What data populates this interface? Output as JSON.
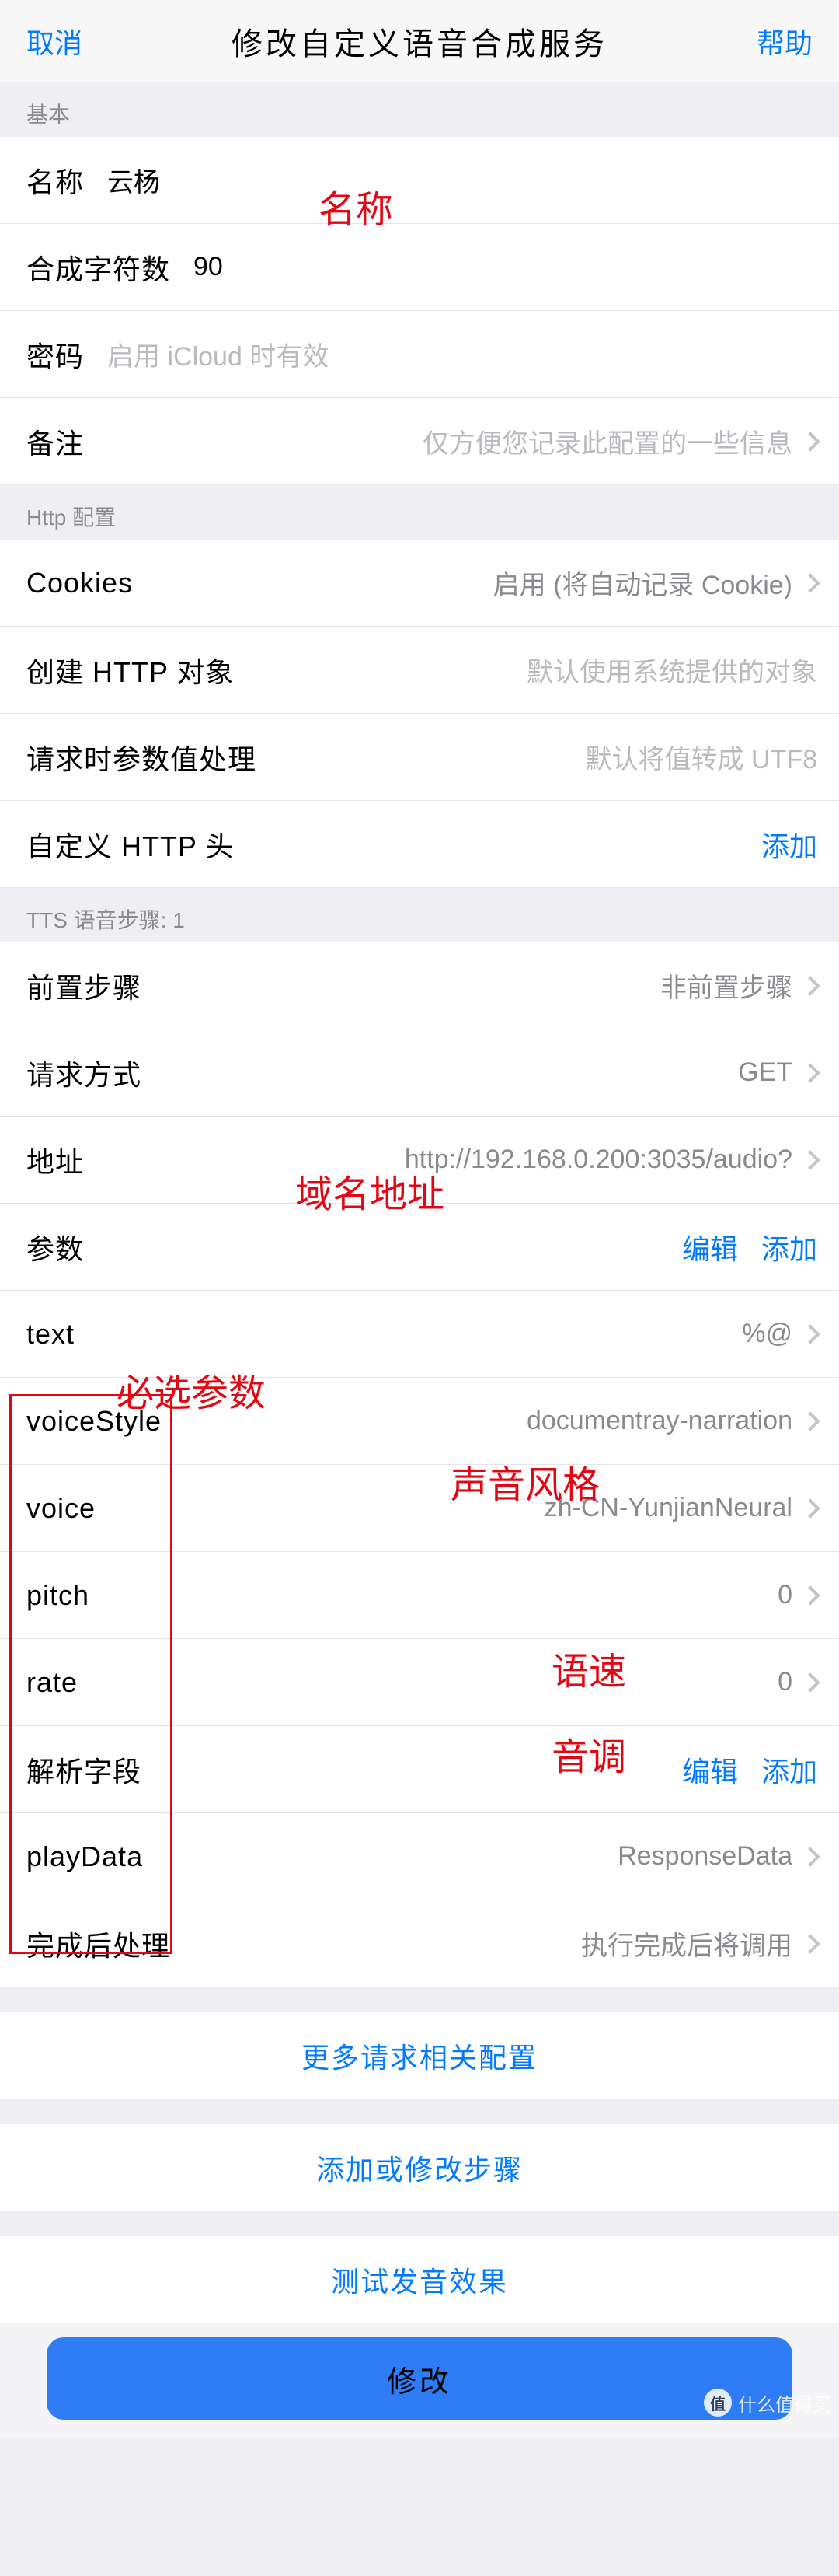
{
  "nav": {
    "cancel": "取消",
    "title": "修改自定义语音合成服务",
    "help": "帮助"
  },
  "sections": {
    "basic": "基本",
    "http": "Http 配置",
    "tts": "TTS 语音步骤: 1"
  },
  "basic": {
    "name_label": "名称",
    "name_value": "云杨",
    "chars_label": "合成字符数",
    "chars_value": "90",
    "pwd_label": "密码",
    "pwd_placeholder": "启用 iCloud 时有效",
    "note_label": "备注",
    "note_placeholder": "仅方便您记录此配置的一些信息"
  },
  "http": {
    "cookies_label": "Cookies",
    "cookies_value": "启用 (将自动记录 Cookie)",
    "create_label": "创建 HTTP 对象",
    "create_value": "默认使用系统提供的对象",
    "param_label": "请求时参数值处理",
    "param_value": "默认将值转成 UTF8",
    "headers_label": "自定义 HTTP 头",
    "headers_action": "添加"
  },
  "tts": {
    "pre_label": "前置步骤",
    "pre_value": "非前置步骤",
    "method_label": "请求方式",
    "method_value": "GET",
    "url_label": "地址",
    "url_value": "http://192.168.0.200:3035/audio?",
    "params_label": "参数",
    "edit": "编辑",
    "add": "添加",
    "params": [
      {
        "k": "text",
        "v": "%@"
      },
      {
        "k": "voiceStyle",
        "v": "documentray-narration"
      },
      {
        "k": "voice",
        "v": "zh-CN-YunjianNeural"
      },
      {
        "k": "pitch",
        "v": "0"
      },
      {
        "k": "rate",
        "v": "0"
      }
    ],
    "parse_label": "解析字段",
    "playdata_k": "playData",
    "playdata_v": "ResponseData",
    "post_label": "完成后处理",
    "post_value": "执行完成后将调用"
  },
  "links": {
    "more": "更多请求相关配置",
    "addstep": "添加或修改步骤",
    "test": "测试发音效果"
  },
  "button": {
    "modify": "修改"
  },
  "annots": {
    "name": "名称",
    "url": "域名地址",
    "required": "必选参数",
    "voice": "声音风格",
    "speed": "语速",
    "pitch": "音调"
  },
  "watermark": "什么值得买"
}
